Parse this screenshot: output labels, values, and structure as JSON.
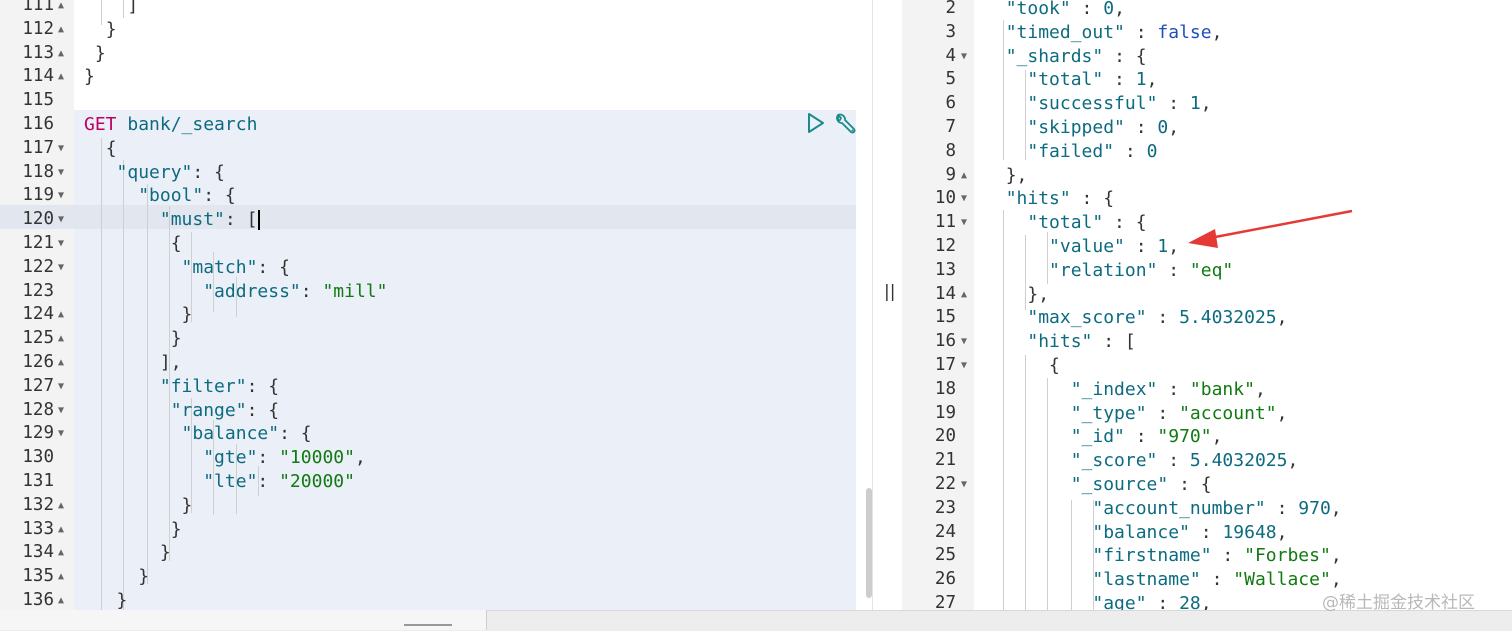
{
  "left_editor": {
    "lines": [
      {
        "n": "111",
        "fold": "▲",
        "html": "    <span class='p'>]</span>"
      },
      {
        "n": "112",
        "fold": "▲",
        "html": "  <span class='p'>}</span>"
      },
      {
        "n": "113",
        "fold": "▲",
        "html": " <span class='p'>}</span>"
      },
      {
        "n": "114",
        "fold": "▲",
        "html": "<span class='p'>}</span>"
      },
      {
        "n": "115",
        "fold": "",
        "html": ""
      },
      {
        "n": "116",
        "fold": "",
        "html": "<span class='method'>GET</span> <span class='url'>bank/_search</span>"
      },
      {
        "n": "117",
        "fold": "▼",
        "html": "  <span class='p'>{</span>"
      },
      {
        "n": "118",
        "fold": "▼",
        "html": "   <span class='k'>\"query\"</span><span class='p'>: {</span>"
      },
      {
        "n": "119",
        "fold": "▼",
        "html": "     <span class='k'>\"bool\"</span><span class='p'>: {</span>"
      },
      {
        "n": "120",
        "fold": "▼",
        "html": "       <span class='k'>\"must\"</span><span class='p'>: [</span><span class='cursor'></span>"
      },
      {
        "n": "121",
        "fold": "▼",
        "html": "        <span class='p'>{</span>"
      },
      {
        "n": "122",
        "fold": "▼",
        "html": "         <span class='k'>\"match\"</span><span class='p'>: {</span>"
      },
      {
        "n": "123",
        "fold": "",
        "html": "           <span class='k'>\"address\"</span><span class='p'>: </span><span class='s'>\"mill\"</span>"
      },
      {
        "n": "124",
        "fold": "▲",
        "html": "         <span class='p'>}</span>"
      },
      {
        "n": "125",
        "fold": "▲",
        "html": "        <span class='p'>}</span>"
      },
      {
        "n": "126",
        "fold": "▲",
        "html": "       <span class='p'>],</span>"
      },
      {
        "n": "127",
        "fold": "▼",
        "html": "       <span class='k'>\"filter\"</span><span class='p'>: {</span>"
      },
      {
        "n": "128",
        "fold": "▼",
        "html": "        <span class='k'>\"range\"</span><span class='p'>: {</span>"
      },
      {
        "n": "129",
        "fold": "▼",
        "html": "         <span class='k'>\"balance\"</span><span class='p'>: {</span>"
      },
      {
        "n": "130",
        "fold": "",
        "html": "           <span class='k'>\"gte\"</span><span class='p'>: </span><span class='s'>\"10000\"</span><span class='p'>,</span>"
      },
      {
        "n": "131",
        "fold": "",
        "html": "           <span class='k'>\"lte\"</span><span class='p'>: </span><span class='s'>\"20000\"</span>"
      },
      {
        "n": "132",
        "fold": "▲",
        "html": "         <span class='p'>}</span>"
      },
      {
        "n": "133",
        "fold": "▲",
        "html": "        <span class='p'>}</span>"
      },
      {
        "n": "134",
        "fold": "▲",
        "html": "       <span class='p'>}</span>"
      },
      {
        "n": "135",
        "fold": "▲",
        "html": "     <span class='p'>}</span>"
      },
      {
        "n": "136",
        "fold": "▲",
        "html": "   <span class='p'>}</span>"
      }
    ]
  },
  "right_editor": {
    "lines": [
      {
        "n": "2",
        "fold": "",
        "html": "  <span class='k'>\"took\"</span><span class='p'> : </span><span class='n'>0</span><span class='p'>,</span>"
      },
      {
        "n": "3",
        "fold": "",
        "html": "  <span class='k'>\"timed_out\"</span><span class='p'> : </span><span class='b'>false</span><span class='p'>,</span>"
      },
      {
        "n": "4",
        "fold": "▼",
        "html": "  <span class='k'>\"_shards\"</span><span class='p'> : {</span>"
      },
      {
        "n": "5",
        "fold": "",
        "html": "    <span class='k'>\"total\"</span><span class='p'> : </span><span class='n'>1</span><span class='p'>,</span>"
      },
      {
        "n": "6",
        "fold": "",
        "html": "    <span class='k'>\"successful\"</span><span class='p'> : </span><span class='n'>1</span><span class='p'>,</span>"
      },
      {
        "n": "7",
        "fold": "",
        "html": "    <span class='k'>\"skipped\"</span><span class='p'> : </span><span class='n'>0</span><span class='p'>,</span>"
      },
      {
        "n": "8",
        "fold": "",
        "html": "    <span class='k'>\"failed\"</span><span class='p'> : </span><span class='n'>0</span>"
      },
      {
        "n": "9",
        "fold": "▲",
        "html": "  <span class='p'>},</span>"
      },
      {
        "n": "10",
        "fold": "▼",
        "html": "  <span class='k'>\"hits\"</span><span class='p'> : {</span>"
      },
      {
        "n": "11",
        "fold": "▼",
        "html": "    <span class='k'>\"total\"</span><span class='p'> : {</span>"
      },
      {
        "n": "12",
        "fold": "",
        "html": "      <span class='k'>\"value\"</span><span class='p'> : </span><span class='n'>1</span><span class='p'>,</span>"
      },
      {
        "n": "13",
        "fold": "",
        "html": "      <span class='k'>\"relation\"</span><span class='p'> : </span><span class='s'>\"eq\"</span>"
      },
      {
        "n": "14",
        "fold": "▲",
        "html": "    <span class='p'>},</span>"
      },
      {
        "n": "15",
        "fold": "",
        "html": "    <span class='k'>\"max_score\"</span><span class='p'> : </span><span class='n'>5.4032025</span><span class='p'>,</span>"
      },
      {
        "n": "16",
        "fold": "▼",
        "html": "    <span class='k'>\"hits\"</span><span class='p'> : [</span>"
      },
      {
        "n": "17",
        "fold": "▼",
        "html": "      <span class='p'>{</span>"
      },
      {
        "n": "18",
        "fold": "",
        "html": "        <span class='k'>\"_index\"</span><span class='p'> : </span><span class='s'>\"bank\"</span><span class='p'>,</span>"
      },
      {
        "n": "19",
        "fold": "",
        "html": "        <span class='k'>\"_type\"</span><span class='p'> : </span><span class='s'>\"account\"</span><span class='p'>,</span>"
      },
      {
        "n": "20",
        "fold": "",
        "html": "        <span class='k'>\"_id\"</span><span class='p'> : </span><span class='s'>\"970\"</span><span class='p'>,</span>"
      },
      {
        "n": "21",
        "fold": "",
        "html": "        <span class='k'>\"_score\"</span><span class='p'> : </span><span class='n'>5.4032025</span><span class='p'>,</span>"
      },
      {
        "n": "22",
        "fold": "▼",
        "html": "        <span class='k'>\"_source\"</span><span class='p'> : {</span>"
      },
      {
        "n": "23",
        "fold": "",
        "html": "          <span class='k'>\"account_number\"</span><span class='p'> : </span><span class='n'>970</span><span class='p'>,</span>"
      },
      {
        "n": "24",
        "fold": "",
        "html": "          <span class='k'>\"balance\"</span><span class='p'> : </span><span class='n'>19648</span><span class='p'>,</span>"
      },
      {
        "n": "25",
        "fold": "",
        "html": "          <span class='k'>\"firstname\"</span><span class='p'> : </span><span class='s'>\"Forbes\"</span><span class='p'>,</span>"
      },
      {
        "n": "26",
        "fold": "",
        "html": "          <span class='k'>\"lastname\"</span><span class='p'> : </span><span class='s'>\"Wallace\"</span><span class='p'>,</span>"
      },
      {
        "n": "27",
        "fold": "",
        "html": "          <span class='k'>\"age\"</span><span class='p'> : </span><span class='n'>28</span><span class='p'>,</span>"
      }
    ]
  },
  "icons": {
    "run": "play-triangle-icon",
    "settings": "wrench-icon",
    "resize": "resize-handle-icon"
  },
  "resize_handle_glyph": "||",
  "watermark": "@稀土掘金技术社区",
  "colors": {
    "key": "#0d6b80",
    "string": "#127a12",
    "method": "#c00060",
    "request_bg": "#ebeff7",
    "arrow": "#e53935"
  }
}
